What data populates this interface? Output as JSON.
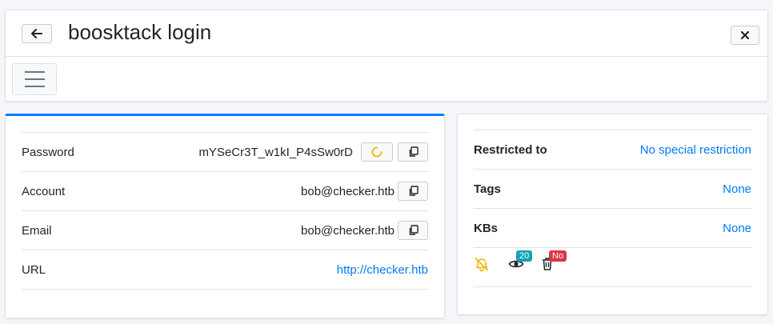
{
  "header": {
    "title": "boosktack login"
  },
  "details": {
    "rows": [
      {
        "label": "Password",
        "value": "mYSeCr3T_w1kI_P4sSw0rD"
      },
      {
        "label": "Account",
        "value": "bob@checker.htb"
      },
      {
        "label": "Email",
        "value": "bob@checker.htb"
      },
      {
        "label": "URL",
        "value": "http://checker.htb"
      }
    ]
  },
  "meta": {
    "rows": [
      {
        "label": "Restricted to",
        "value": "No special restriction"
      },
      {
        "label": "Tags",
        "value": "None"
      },
      {
        "label": "KBs",
        "value": "None"
      }
    ],
    "views_badge": "20",
    "delete_badge": "No"
  },
  "icons": {
    "back": "arrow-left-icon",
    "close": "close-icon",
    "menu": "hamburger-menu-icon",
    "refresh": "refresh-spinner-icon",
    "copy": "copy-icon",
    "notify": "bell-slash-icon",
    "views": "eye-icon",
    "delete": "trash-icon"
  },
  "colors": {
    "accent": "#007bff",
    "warning": "#f0b400",
    "info": "#17a2b8",
    "danger": "#dc3545"
  }
}
